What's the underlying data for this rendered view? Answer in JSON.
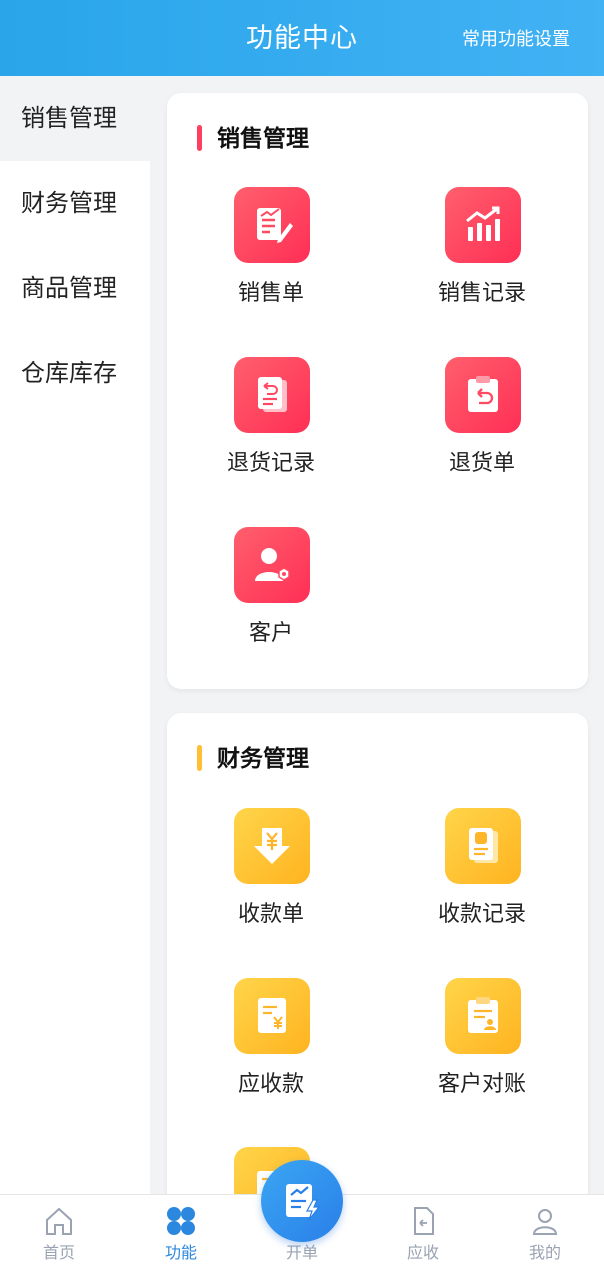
{
  "header": {
    "title": "功能中心",
    "settings_label": "常用功能设置"
  },
  "sidebar": {
    "items": [
      {
        "label": "销售管理",
        "active": true
      },
      {
        "label": "财务管理",
        "active": false
      },
      {
        "label": "商品管理",
        "active": false
      },
      {
        "label": "仓库库存",
        "active": false
      }
    ]
  },
  "sections": [
    {
      "title": "销售管理",
      "accent": "#ff3f5f",
      "items": [
        {
          "label": "销售单",
          "icon": "sales-order-icon"
        },
        {
          "label": "销售记录",
          "icon": "sales-record-icon"
        },
        {
          "label": "退货记录",
          "icon": "return-record-icon"
        },
        {
          "label": "退货单",
          "icon": "return-order-icon"
        },
        {
          "label": "客户",
          "icon": "customer-icon"
        }
      ]
    },
    {
      "title": "财务管理",
      "accent": "#ffbe33",
      "items": [
        {
          "label": "收款单",
          "icon": "receipt-order-icon"
        },
        {
          "label": "收款记录",
          "icon": "receipt-record-icon"
        },
        {
          "label": "应收款",
          "icon": "receivable-icon"
        },
        {
          "label": "客户对账",
          "icon": "customer-reconcile-icon"
        }
      ]
    }
  ],
  "bottom_nav": {
    "items": [
      {
        "label": "首页",
        "icon": "home-icon",
        "active": false
      },
      {
        "label": "功能",
        "icon": "function-grid-icon",
        "active": true
      },
      {
        "label": "开单",
        "icon": "create-order-icon",
        "active": false
      },
      {
        "label": "应收",
        "icon": "receivable-doc-icon",
        "active": false
      },
      {
        "label": "我的",
        "icon": "profile-icon",
        "active": false
      }
    ]
  },
  "colors": {
    "header": "#2aa5ea",
    "active_nav": "#2c88de",
    "inactive_nav": "#9aa3b2"
  }
}
